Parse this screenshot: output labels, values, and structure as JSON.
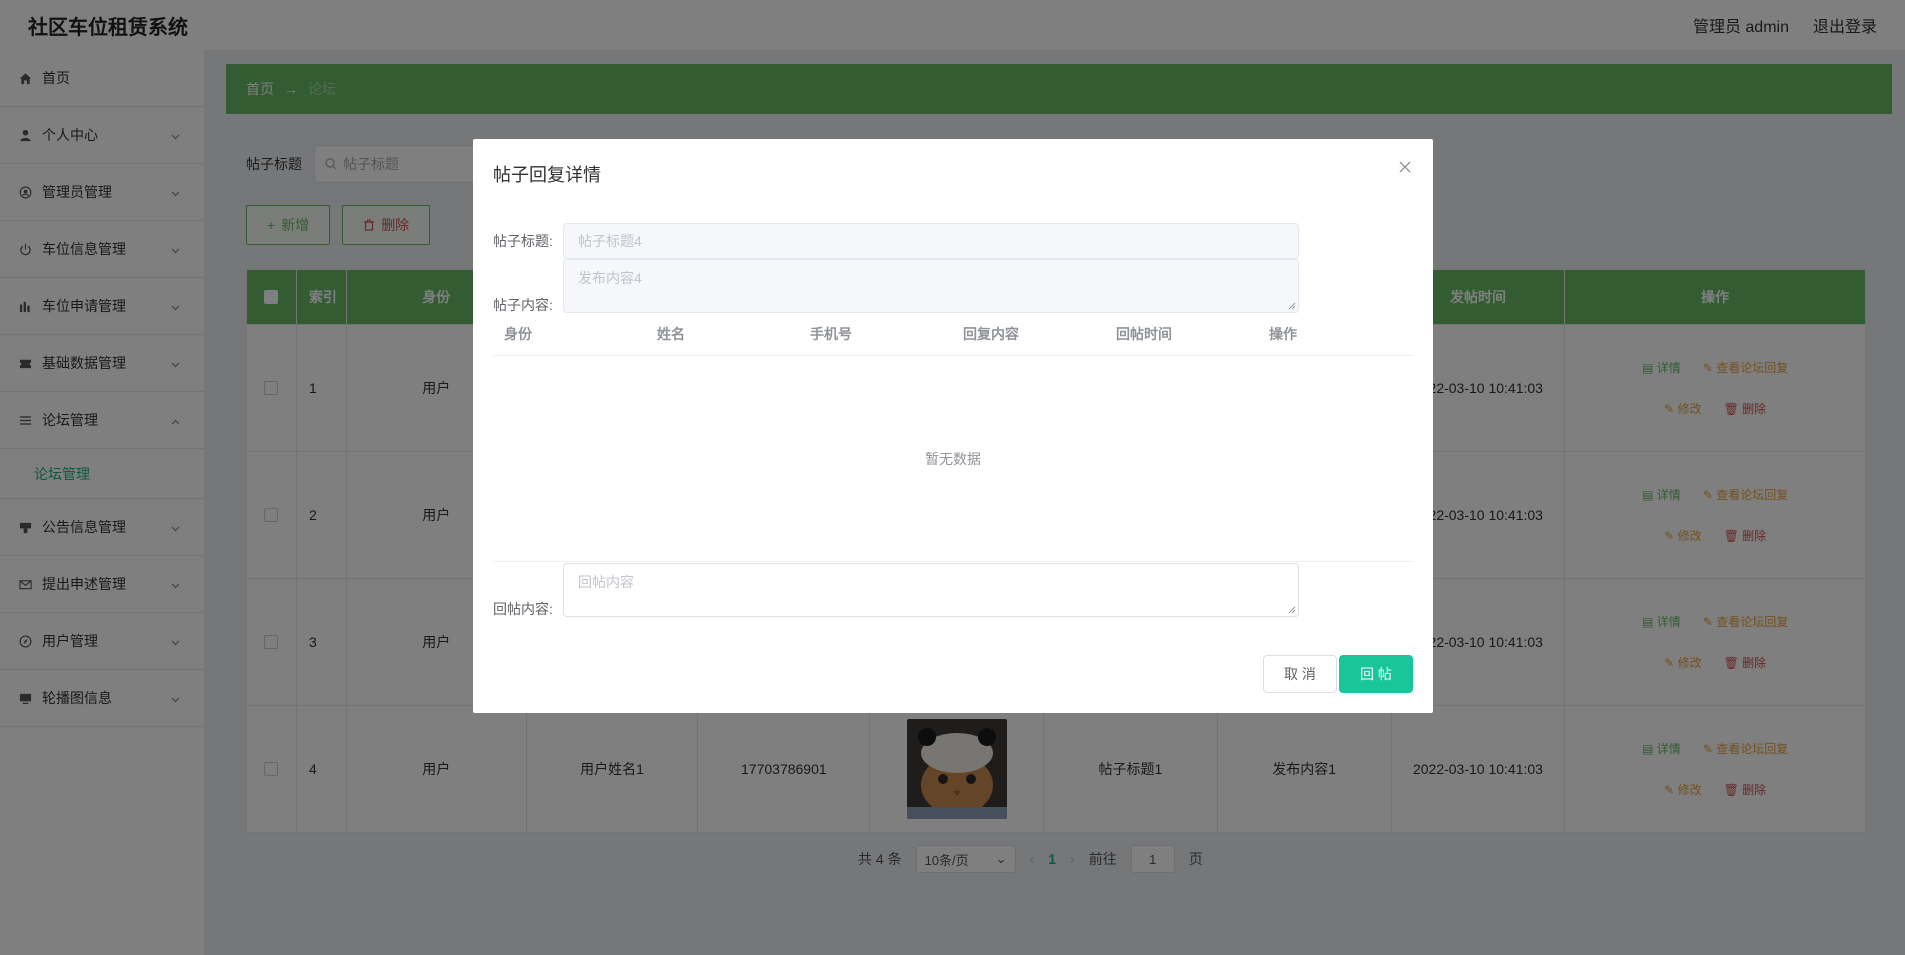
{
  "header": {
    "title": "社区车位租赁系统",
    "user_label": "管理员 admin",
    "logout_label": "退出登录"
  },
  "sidebar": {
    "items": [
      {
        "label": "首页",
        "icon": "home-icon",
        "has_chevron": false
      },
      {
        "label": "个人中心",
        "icon": "user-icon",
        "has_chevron": true
      },
      {
        "label": "管理员管理",
        "icon": "admin-icon",
        "has_chevron": true
      },
      {
        "label": "车位信息管理",
        "icon": "power-icon",
        "has_chevron": true
      },
      {
        "label": "车位申请管理",
        "icon": "chart-icon",
        "has_chevron": true
      },
      {
        "label": "基础数据管理",
        "icon": "ticket-icon",
        "has_chevron": true
      },
      {
        "label": "论坛管理",
        "icon": "list-icon",
        "has_chevron": true,
        "expanded": true
      },
      {
        "label": "公告信息管理",
        "icon": "notice-icon",
        "has_chevron": true
      },
      {
        "label": "提出申述管理",
        "icon": "mail-icon",
        "has_chevron": true
      },
      {
        "label": "用户管理",
        "icon": "compass-icon",
        "has_chevron": true
      },
      {
        "label": "轮播图信息",
        "icon": "monitor-icon",
        "has_chevron": true
      }
    ],
    "sub_item": "论坛管理"
  },
  "breadcrumb": {
    "home": "首页",
    "arrow": "→",
    "current": "论坛"
  },
  "search": {
    "label": "帖子标题",
    "placeholder": "帖子标题"
  },
  "buttons": {
    "add": "新增",
    "delete": "删除"
  },
  "table": {
    "headers": [
      "索引",
      "身份",
      "发帖时间",
      "操作"
    ],
    "rows": [
      {
        "index": "1",
        "role": "用户",
        "name": "",
        "phone": "",
        "title": "",
        "content": "",
        "time": "2022-03-10 10:41:03",
        "show_photo": false
      },
      {
        "index": "2",
        "role": "用户",
        "name": "",
        "phone": "",
        "title": "",
        "content": "",
        "time": "2022-03-10 10:41:03",
        "show_photo": false
      },
      {
        "index": "3",
        "role": "用户",
        "name": "",
        "phone": "",
        "title": "",
        "content": "",
        "time": "2022-03-10 10:41:03",
        "show_photo": false
      },
      {
        "index": "4",
        "role": "用户",
        "name": "用户姓名1",
        "phone": "17703786901",
        "title": "帖子标题1",
        "content": "发布内容1",
        "time": "2022-03-10 10:41:03",
        "show_photo": true
      }
    ],
    "ops": {
      "detail": "详情",
      "view": "查看论坛回复",
      "edit": "修改",
      "delete": "删除"
    }
  },
  "pagination": {
    "total": "共 4 条",
    "page_size": "10条/页",
    "current": "1",
    "goto_prefix": "前往",
    "goto_value": "1",
    "goto_suffix": "页"
  },
  "modal": {
    "title": "帖子回复详情",
    "title_label": "帖子标题:",
    "title_value": "帖子标题4",
    "content_label": "帖子内容:",
    "content_value": "发布内容4",
    "columns": [
      "身份",
      "姓名",
      "手机号",
      "回复内容",
      "回帖时间",
      "操作"
    ],
    "empty_text": "暂无数据",
    "reply_label": "回帖内容:",
    "reply_placeholder": "回帖内容",
    "cancel": "取 消",
    "submit": "回 帖"
  },
  "colors": {
    "primary": "#66b965",
    "accent": "#19c69a",
    "danger": "#d0524e",
    "warning": "#e6a23c"
  }
}
